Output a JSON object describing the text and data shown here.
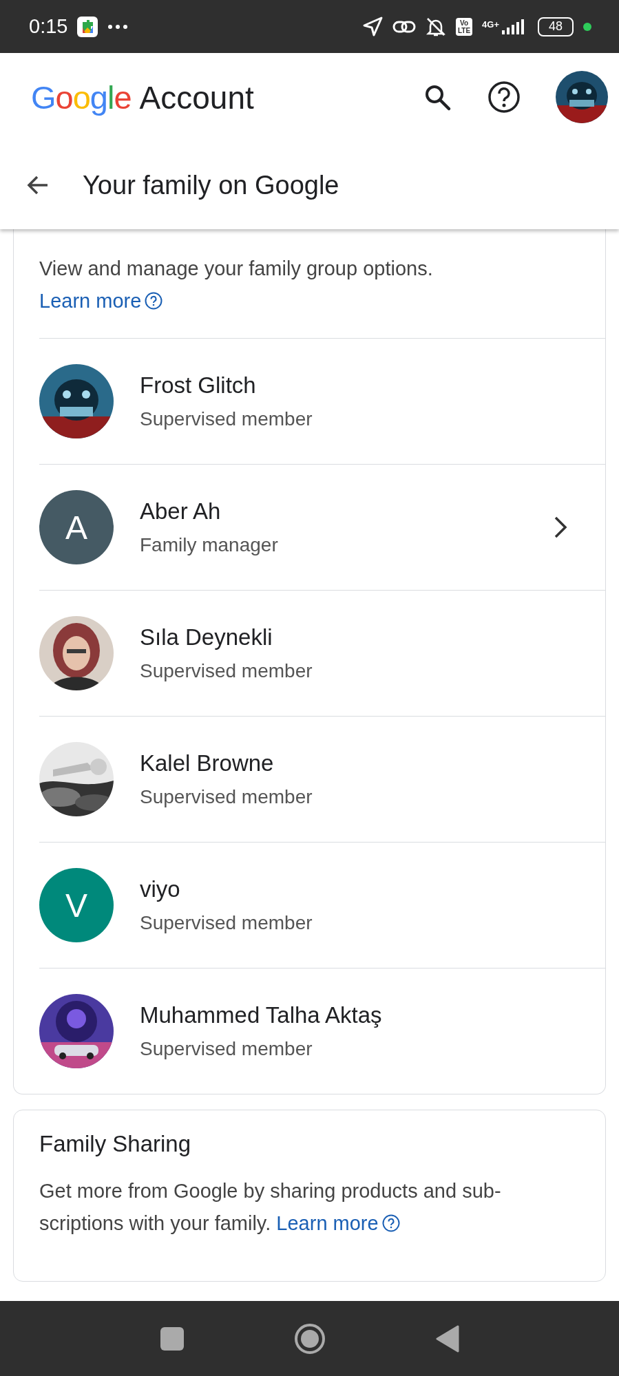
{
  "status_bar": {
    "time": "0:15",
    "network": "4G+",
    "volte": [
      "Vo",
      "LTE"
    ],
    "battery": "48"
  },
  "app_bar": {
    "brand": "Google",
    "product": "Account"
  },
  "page_header": {
    "title": "Your family on Google"
  },
  "members_card": {
    "description": "View and manage your family group options.",
    "link": "Learn more",
    "members": [
      {
        "name": "Frost Glitch",
        "role": "Supervised member",
        "color": "#2a6a8a",
        "openable": false
      },
      {
        "name": "Aber Ah",
        "role": "Family manager",
        "kind": "letter",
        "letter": "A",
        "color": "#455a64",
        "openable": true
      },
      {
        "name": "Sıla Deynekli",
        "role": "Supervised member",
        "color": "#8a3a3a",
        "openable": false
      },
      {
        "name": "Kalel Browne",
        "role": "Supervised member",
        "color": "#777777",
        "openable": false
      },
      {
        "name": "viyo",
        "role": "Supervised member",
        "kind": "letter",
        "letter": "V",
        "color": "#00897b",
        "openable": false
      },
      {
        "name": "Muhammed Talha Aktaş",
        "role": "Supervised member",
        "color": "#4a3aa0",
        "openable": false
      }
    ]
  },
  "sharing_card": {
    "title": "Family Sharing",
    "description": "Get more from Google by sharing products and sub-scriptions with your family.",
    "link": "Learn more"
  }
}
